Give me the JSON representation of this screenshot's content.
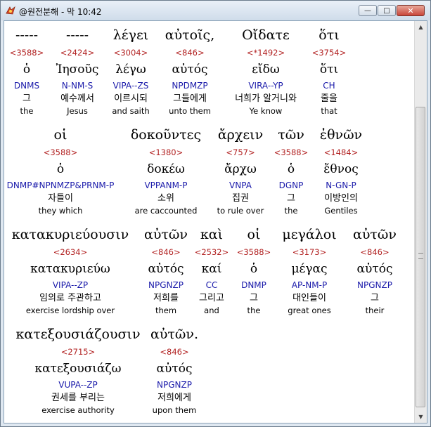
{
  "window": {
    "title": "@원전분해 - 막 10:42",
    "min_glyph": "—",
    "max_glyph": "□",
    "close_glyph": "✕",
    "app_icon": "app-icon"
  },
  "scrollbar": {
    "up_glyph": "▲",
    "down_glyph": "▼"
  },
  "lines": [
    {
      "words": [
        {
          "greek": "-----",
          "strong": "<3588>",
          "lemma": "ὁ",
          "parse": "DNMS",
          "korean": "그",
          "english": "the"
        },
        {
          "greek": "-----",
          "strong": "<2424>",
          "lemma": "Ἰησοῦς",
          "parse": "N-NM-S",
          "korean": "예수께서",
          "english": "Jesus"
        },
        {
          "greek": "λέγει",
          "strong": "<3004>",
          "lemma": "λέγω",
          "parse": "VIPA--ZS",
          "korean": "이르시되",
          "english": "and saith"
        },
        {
          "greek": "αὐτοῖς,",
          "strong": "<846>",
          "lemma": "αὐτός",
          "parse": "NPDMZP",
          "korean": "그들에게",
          "english": "unto them"
        },
        {
          "greek": "Οἴδατε",
          "strong": "<*1492>",
          "lemma": "εἴδω",
          "parse": "VIRA--YP",
          "korean": "너희가 알거니와",
          "english": "Ye know"
        },
        {
          "greek": "ὅτι",
          "strong": "<3754>",
          "lemma": "ὅτι",
          "parse": "CH",
          "korean": "줄을",
          "english": "that"
        }
      ]
    },
    {
      "words": [
        {
          "greek": "οἱ",
          "strong": "<3588>",
          "lemma": "ὁ",
          "parse": "DNMP#NPNMZP&PRNM-P",
          "korean": "자들이",
          "english": "they which"
        },
        {
          "greek": "δοκοῦντες",
          "strong": "<1380>",
          "lemma": "δοκέω",
          "parse": "VPPANM-P",
          "korean": "소위",
          "english": "are caccounted"
        },
        {
          "greek": "ἄρχειν",
          "strong": "<757>",
          "lemma": "ἄρχω",
          "parse": "VNPA",
          "korean": "집권",
          "english": "to rule over"
        },
        {
          "greek": "τῶν",
          "strong": "<3588>",
          "lemma": "ὁ",
          "parse": "DGNP",
          "korean": "그",
          "english": "the"
        },
        {
          "greek": "ἐθνῶν",
          "strong": "<1484>",
          "lemma": "ἔθνος",
          "parse": "N-GN-P",
          "korean": "이방인의",
          "english": "Gentiles"
        }
      ]
    },
    {
      "words": [
        {
          "greek": "κατακυριεύουσιν",
          "strong": "<2634>",
          "lemma": "κατακυριεύω",
          "parse": "VIPA--ZP",
          "korean": "임의로 주관하고",
          "english": "exercise lordship over"
        },
        {
          "greek": "αὐτῶν",
          "strong": "<846>",
          "lemma": "αὐτός",
          "parse": "NPGNZP",
          "korean": "저희를",
          "english": "them"
        },
        {
          "greek": "καὶ",
          "strong": "<2532>",
          "lemma": "καί",
          "parse": "CC",
          "korean": "그리고",
          "english": "and"
        },
        {
          "greek": "οἱ",
          "strong": "<3588>",
          "lemma": "ὁ",
          "parse": "DNMP",
          "korean": "그",
          "english": "the"
        },
        {
          "greek": "μεγάλοι",
          "strong": "<3173>",
          "lemma": "μέγας",
          "parse": "AP-NM-P",
          "korean": "대인들이",
          "english": "great ones"
        },
        {
          "greek": "αὐτῶν",
          "strong": "<846>",
          "lemma": "αὐτός",
          "parse": "NPGNZP",
          "korean": "그",
          "english": "their"
        }
      ]
    },
    {
      "words": [
        {
          "greek": "κατεξουσιάζουσιν",
          "strong": "<2715>",
          "lemma": "κατεξουσιάζω",
          "parse": "VUPA--ZP",
          "korean": "권세를 부리는",
          "english": "exercise authority"
        },
        {
          "greek": "αὐτῶν.",
          "strong": "<846>",
          "lemma": "αὐτός",
          "parse": "NPGNZP",
          "korean": "저희에게",
          "english": "upon them"
        }
      ]
    }
  ]
}
